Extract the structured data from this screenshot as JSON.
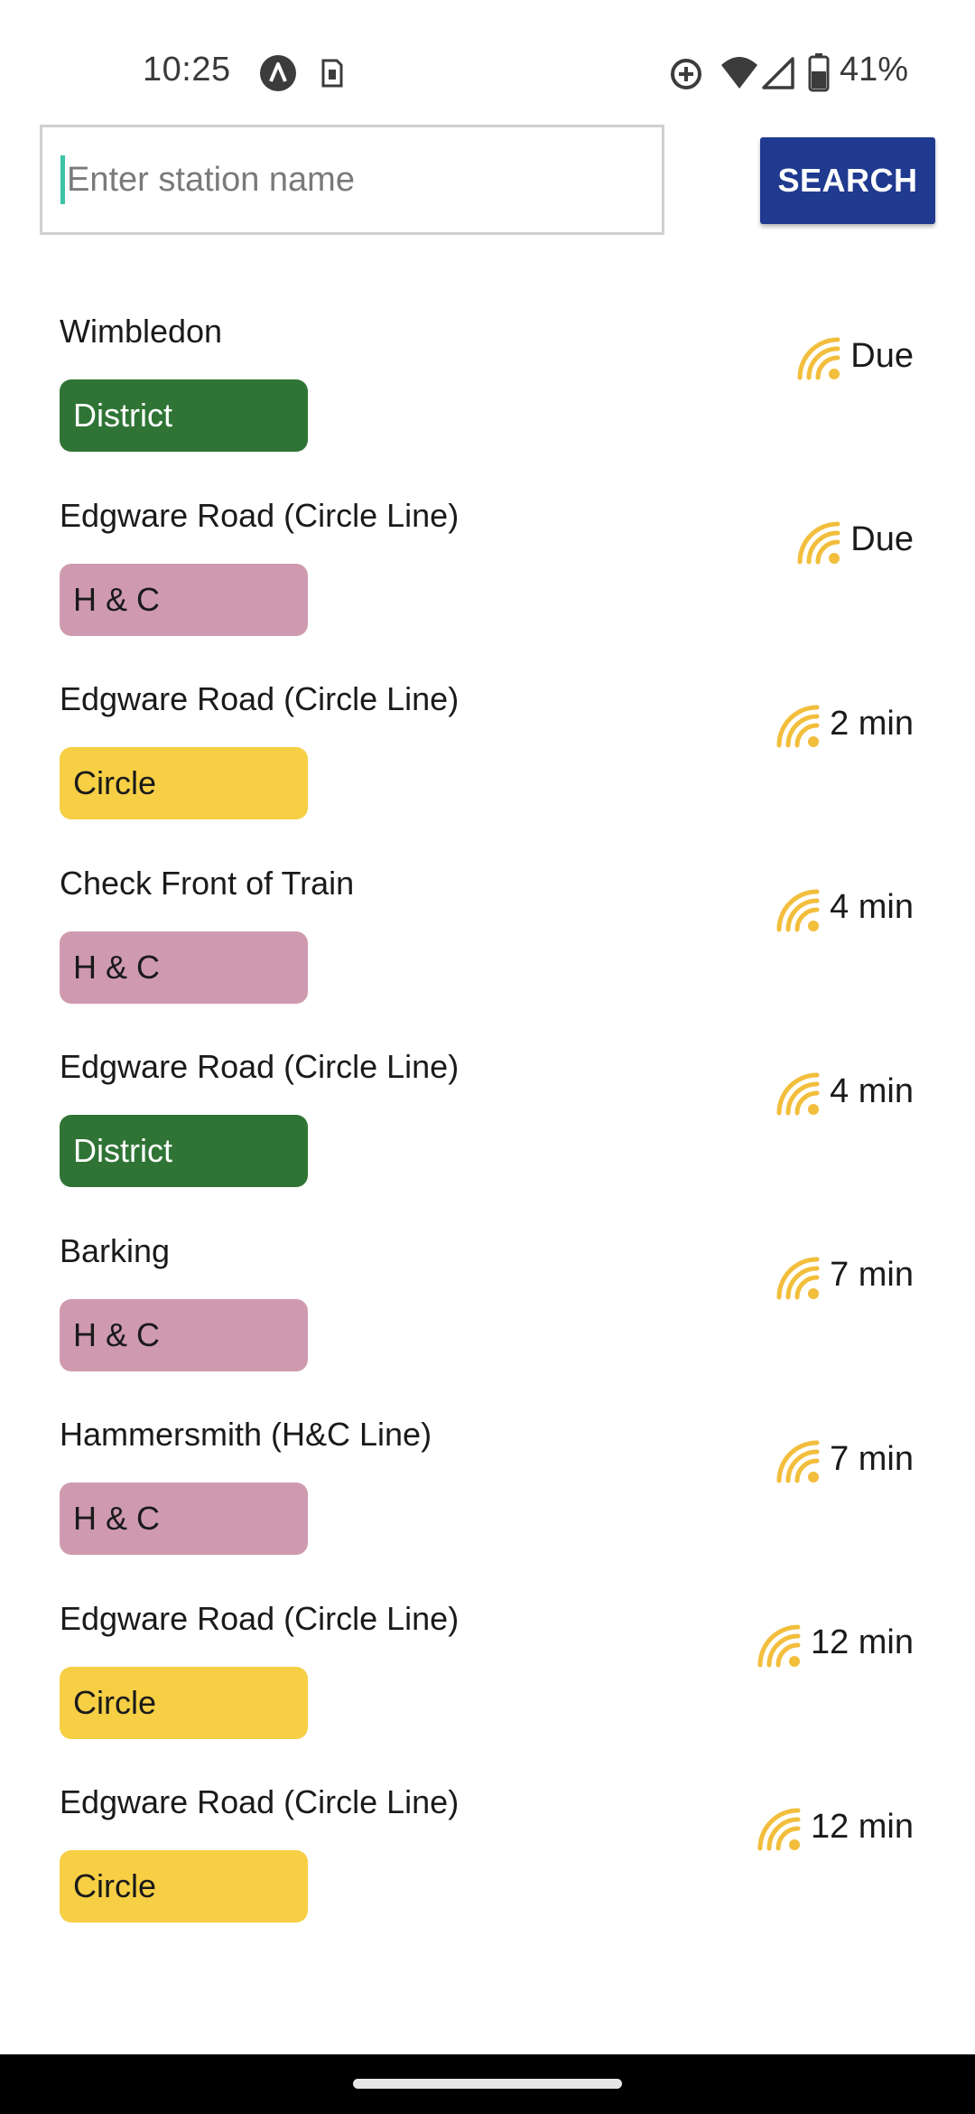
{
  "status_bar": {
    "time": "10:25",
    "battery_percent": "41%",
    "icons": [
      "app-notification-icon",
      "sim-card-icon",
      "data-saver-icon",
      "wifi-icon",
      "cell-signal-icon",
      "battery-icon"
    ]
  },
  "search": {
    "placeholder": "Enter station name",
    "button_label": "SEARCH"
  },
  "line_colors": {
    "District": "#2f7435",
    "H & C": "#cf9aaf",
    "Circle": "#f6cf45"
  },
  "accent_colors": {
    "search_button": "#1f3a8f",
    "live_icon": "#f2be3c",
    "caret": "#3cc3a8"
  },
  "arrivals": [
    {
      "destination": "Wimbledon",
      "line": "District",
      "eta": "Due"
    },
    {
      "destination": "Edgware Road (Circle Line)",
      "line": "H & C",
      "eta": "Due"
    },
    {
      "destination": "Edgware Road (Circle Line)",
      "line": "Circle",
      "eta": "2 min"
    },
    {
      "destination": "Check Front of Train",
      "line": "H & C",
      "eta": "4 min"
    },
    {
      "destination": "Edgware Road (Circle Line)",
      "line": "District",
      "eta": "4 min"
    },
    {
      "destination": "Barking",
      "line": "H & C",
      "eta": "7 min"
    },
    {
      "destination": "Hammersmith (H&C Line)",
      "line": "H & C",
      "eta": "7 min"
    },
    {
      "destination": "Edgware Road (Circle Line)",
      "line": "Circle",
      "eta": "12 min"
    },
    {
      "destination": "Edgware Road (Circle Line)",
      "line": "Circle",
      "eta": "12 min"
    }
  ]
}
